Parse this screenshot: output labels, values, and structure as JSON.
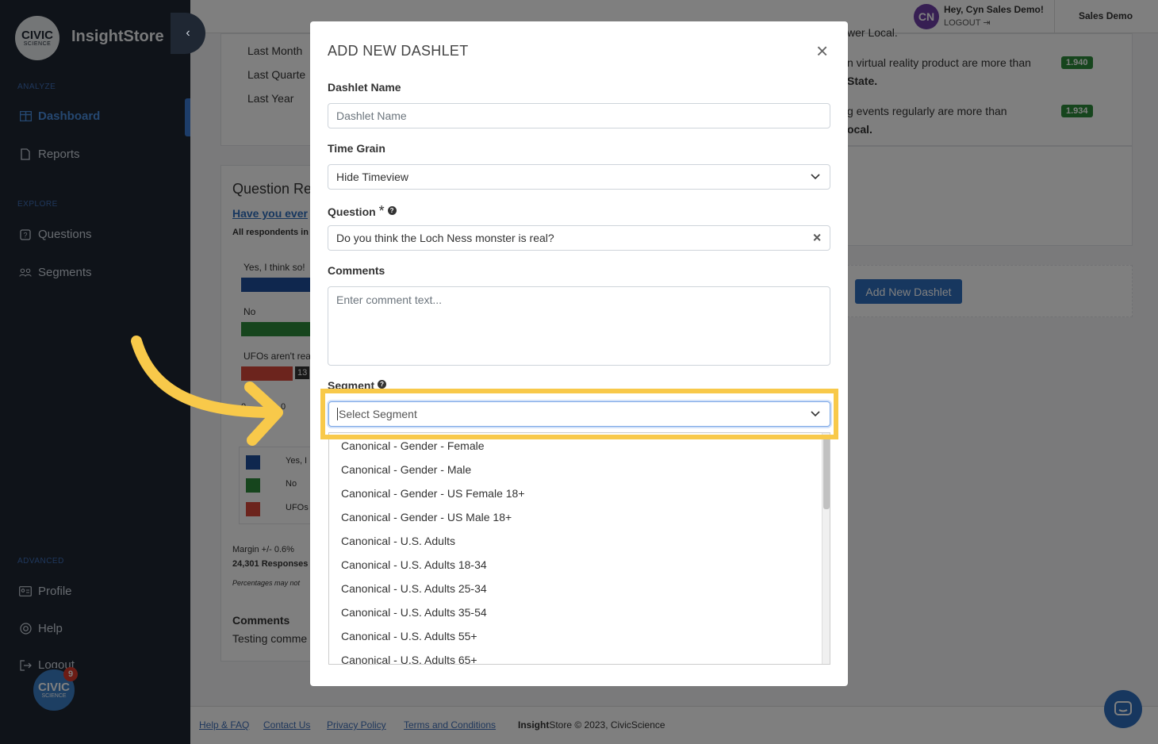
{
  "sidebar": {
    "logo": {
      "line1": "CIVIC",
      "line2": "SCIENCE"
    },
    "brand": "InsightStore",
    "sections": {
      "analyze": "ANALYZE",
      "explore": "EXPLORE",
      "advanced": "ADVANCED"
    },
    "items": [
      {
        "label": "Dashboard",
        "icon": "dashboard-icon"
      },
      {
        "label": "Reports",
        "icon": "document-icon"
      },
      {
        "label": "Questions",
        "icon": "question-icon"
      },
      {
        "label": "Segments",
        "icon": "people-icon"
      },
      {
        "label": "Profile",
        "icon": "id-card-icon"
      },
      {
        "label": "Help",
        "icon": "lifebuoy-icon"
      },
      {
        "label": "Logout",
        "icon": "logout-icon"
      }
    ],
    "notification_count": "9"
  },
  "topbar": {
    "avatar_initials": "CN",
    "greeting": "Hey, Cyn Sales Demo!",
    "logout": "LOGOUT",
    "org": "Sales Demo"
  },
  "background": {
    "periods": [
      "Last Month",
      "Last Quarte",
      "Last Year"
    ],
    "insights": [
      {
        "line1": "wer Local.",
        "line2": ""
      },
      {
        "line1": "n virtual reality product are more than",
        "line2": "State.",
        "score": "1.940"
      },
      {
        "line1": "g events regularly are more than",
        "line2": "ocal.",
        "score": "1.934"
      }
    ],
    "question_card": {
      "title": "Question Re",
      "link": "Have you ever",
      "filter": "All respondents in",
      "answers": [
        "Yes, I think so!",
        "No",
        "UFOs aren't rea"
      ],
      "bar_value": "13",
      "axis": [
        "0",
        "0"
      ],
      "legend": [
        "Yes, I",
        "No",
        "UFOs"
      ],
      "margin": "Margin +/- 0.6%",
      "responses": "24,301 Responses",
      "note": "Percentages may not",
      "comments_title": "Comments",
      "comments_text": "Testing comme"
    },
    "add_dashlet_button": "Add New Dashlet"
  },
  "modal": {
    "title": "ADD NEW DASHLET",
    "dashlet_name_label": "Dashlet Name",
    "dashlet_name_placeholder": "Dashlet Name",
    "time_grain_label": "Time Grain",
    "time_grain_value": "Hide Timeview",
    "question_label": "Question",
    "question_required": "*",
    "question_value": "Do you think the Loch Ness monster is real?",
    "comments_label": "Comments",
    "comments_placeholder": "Enter comment text...",
    "segment_label": "Segment",
    "segment_placeholder": "Select Segment",
    "segment_options": [
      "Canonical - Gender - Female",
      "Canonical - Gender - Male",
      "Canonical - Gender - US Female 18+",
      "Canonical - Gender - US Male 18+",
      "Canonical - U.S. Adults",
      "Canonical - U.S. Adults 18-34",
      "Canonical - U.S. Adults 25-34",
      "Canonical - U.S. Adults 35-54",
      "Canonical - U.S. Adults 55+",
      "Canonical - U.S. Adults 65+"
    ]
  },
  "footer": {
    "links": [
      "Help & FAQ",
      "Contact Us",
      "Privacy Policy",
      "Terms and Conditions"
    ],
    "brand_bold": "Insight",
    "copyright": "Store © 2023, CivicScience"
  },
  "colors": {
    "sidebar_bg": "#1f2733",
    "accent": "#2f6fbf",
    "highlight": "#f8c94a",
    "bar_yes": "#1f4e9c",
    "bar_no": "#2d8a3a",
    "bar_ufo": "#d8493b"
  }
}
